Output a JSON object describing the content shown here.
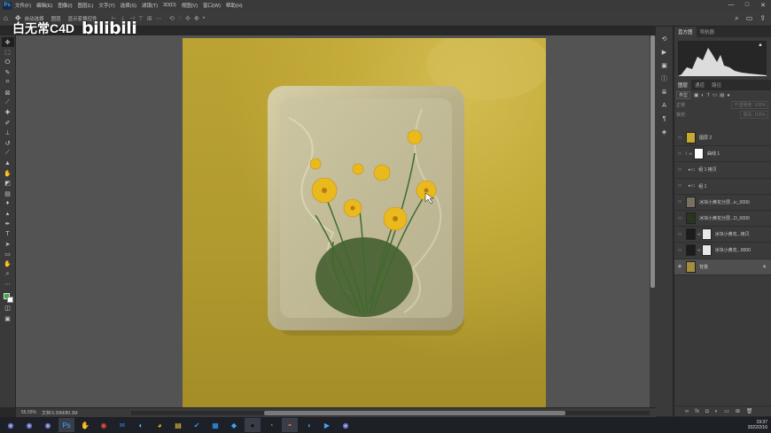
{
  "menu": {
    "logo": "Ps",
    "items": [
      "文件(F)",
      "编辑(E)",
      "图像(I)",
      "图层(L)",
      "文字(Y)",
      "选择(S)",
      "滤镜(T)",
      "3D(D)",
      "视图(V)",
      "窗口(W)",
      "帮助(H)"
    ],
    "window_controls": [
      "—",
      "□",
      "✕"
    ]
  },
  "options_bar": {
    "auto_select": "自动选择",
    "group_value": "图层",
    "show_transform": "显示变换控件"
  },
  "watermark": {
    "text": "白无常C4D",
    "logo": "bilibili"
  },
  "status": {
    "zoom": "56.55%",
    "doc_info": "文档:5.39M/80.3M"
  },
  "panels": {
    "histogram_tabs": [
      "直方图",
      "导航器"
    ],
    "layer_tabs": [
      "图层",
      "通道",
      "路径"
    ],
    "filter_label": "类型",
    "mode_label": "正常",
    "opacity_label": "不透明度:",
    "opacity_value": "100%",
    "lock_label": "锁定:",
    "fill_label": "填充:",
    "fill_value": "100%",
    "layers": [
      {
        "name": "图层 2",
        "kind": "pixel",
        "thumb": "#c6a832",
        "eye": false
      },
      {
        "name": "曲线 1",
        "kind": "adjust",
        "eye": false
      },
      {
        "name": "组 1 拷贝",
        "kind": "group",
        "eye": false
      },
      {
        "name": "组 1",
        "kind": "group",
        "eye": false
      },
      {
        "name": "冰块小黄花分层...ic_0000",
        "kind": "pixel",
        "thumb": "#7a7060",
        "eye": false
      },
      {
        "name": "冰块小黄花分层...D_0000",
        "kind": "pixel",
        "thumb": "#2a3520",
        "eye": false
      },
      {
        "name": "冰块小黄花...拷贝",
        "kind": "masked",
        "thumb": "#1c1c1c",
        "eye": false
      },
      {
        "name": "冰块小黄花...0000",
        "kind": "masked",
        "thumb": "#1c1c1c",
        "eye": false
      },
      {
        "name": "背景",
        "kind": "background",
        "thumb": "#a48f3c",
        "eye": true
      }
    ]
  },
  "taskbar": {
    "apps": [
      {
        "icon": "◉",
        "color": "#9aa7ff"
      },
      {
        "icon": "◉",
        "color": "#9aa7ff"
      },
      {
        "icon": "◉",
        "color": "#9aa7ff"
      },
      {
        "icon": "Ps",
        "color": "#31a8ff",
        "active": true
      },
      {
        "icon": "✋",
        "color": "#e9a36a"
      },
      {
        "icon": "◉",
        "color": "#e84c3d"
      },
      {
        "icon": "✉",
        "color": "#2e7bd6"
      },
      {
        "icon": "◐",
        "color": "#4cc2ff"
      },
      {
        "icon": "◕",
        "color": "#f4b400"
      },
      {
        "icon": "▤",
        "color": "#ffd23a"
      },
      {
        "icon": "✔",
        "color": "#3a8df5"
      },
      {
        "icon": "▦",
        "color": "#2aa6ff"
      },
      {
        "icon": "◆",
        "color": "#38a7ff"
      },
      {
        "icon": "●",
        "color": "#111111",
        "active": true
      },
      {
        "icon": "◔",
        "color": "#4caf50"
      },
      {
        "icon": "◓",
        "color": "#e07b2e",
        "active": true
      },
      {
        "icon": "◑",
        "color": "#2a9bd6"
      },
      {
        "icon": "▶",
        "color": "#45a6ff"
      },
      {
        "icon": "◉",
        "color": "#9aa7ff"
      }
    ],
    "time": "19:37",
    "date": "2022/2/16"
  }
}
